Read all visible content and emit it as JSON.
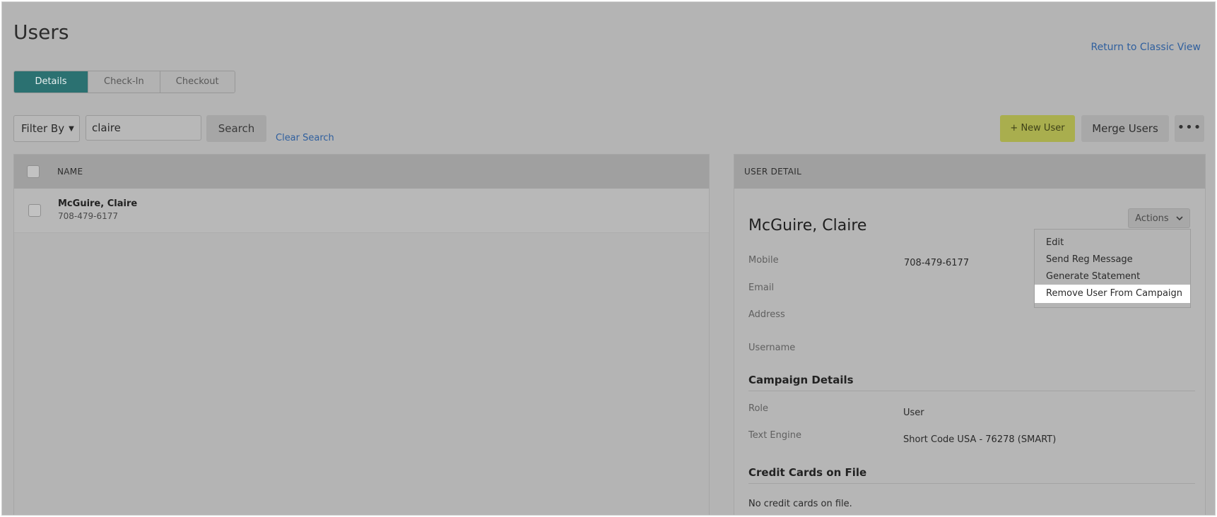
{
  "page": {
    "title": "Users",
    "classic_view_link": "Return to Classic View"
  },
  "tabs": [
    {
      "label": "Details"
    },
    {
      "label": "Check-In"
    },
    {
      "label": "Checkout"
    }
  ],
  "toolbar": {
    "filter_label": "Filter By",
    "search_value": "claire",
    "search_button": "Search",
    "clear_search": "Clear Search",
    "new_user": "+ New User",
    "merge_users": "Merge Users",
    "more": "•••"
  },
  "list": {
    "column_name": "NAME",
    "rows": [
      {
        "name": "McGuire, Claire",
        "phone": "708-479-6177"
      }
    ]
  },
  "detail": {
    "header": "USER DETAIL",
    "name": "McGuire, Claire",
    "actions_label": "Actions",
    "actions_menu": [
      "Edit",
      "Send Reg Message",
      "Generate Statement",
      "Remove User From Campaign"
    ],
    "fields": {
      "mobile_label": "Mobile",
      "mobile_value": "708-479-6177",
      "email_label": "Email",
      "address_label": "Address",
      "username_label": "Username"
    },
    "campaign": {
      "title": "Campaign Details",
      "role_label": "Role",
      "role_value": "User",
      "text_engine_label": "Text Engine",
      "text_engine_value": "Short Code USA - 76278 (SMART)"
    },
    "cards": {
      "title": "Credit Cards on File",
      "empty": "No credit cards on file."
    }
  },
  "colors": {
    "primary_tab": "#2b7171",
    "new_user_button": "#a9ae4e",
    "link": "#2f5f9e"
  }
}
